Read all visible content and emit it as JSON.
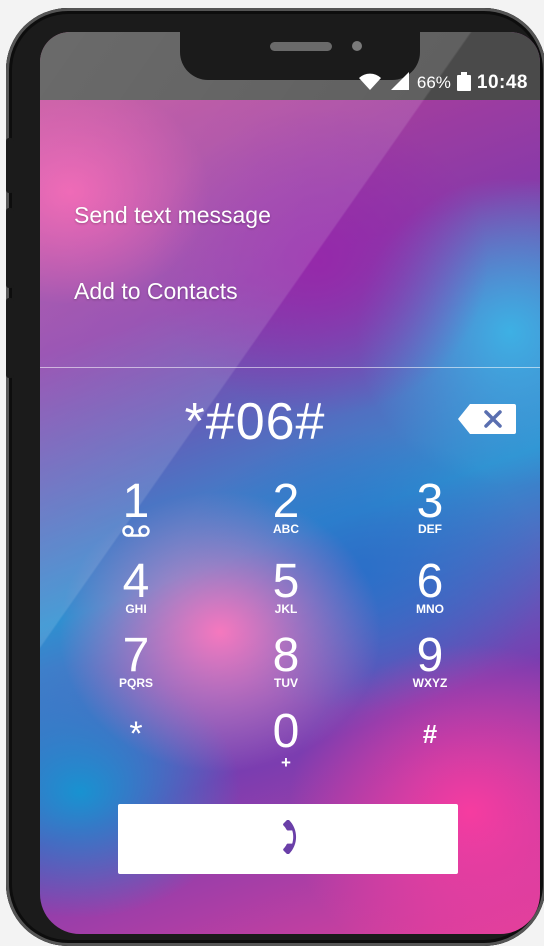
{
  "status_bar": {
    "battery": "66%",
    "time": "10:48"
  },
  "menu": {
    "send_text": "Send text message",
    "add_contacts": "Add to Contacts"
  },
  "dialer": {
    "number": "*#06#"
  },
  "keypad": [
    {
      "digit": "1",
      "letters": ""
    },
    {
      "digit": "2",
      "letters": "ABC"
    },
    {
      "digit": "3",
      "letters": "DEF"
    },
    {
      "digit": "4",
      "letters": "GHI"
    },
    {
      "digit": "5",
      "letters": "JKL"
    },
    {
      "digit": "6",
      "letters": "MNO"
    },
    {
      "digit": "7",
      "letters": "PQRS"
    },
    {
      "digit": "8",
      "letters": "TUV"
    },
    {
      "digit": "9",
      "letters": "WXYZ"
    },
    {
      "digit": "*",
      "letters": ""
    },
    {
      "digit": "0",
      "letters": "+"
    },
    {
      "digit": "#",
      "letters": ""
    }
  ],
  "icons": {
    "wifi": "wifi-icon",
    "signal": "signal-icon",
    "battery": "battery-icon",
    "backspace": "backspace-icon",
    "voicemail": "voicemail-icon",
    "call": "phone-icon"
  },
  "colors": {
    "call_icon": "#6a3fa8",
    "backspace_icon": "#5a6fb0"
  }
}
